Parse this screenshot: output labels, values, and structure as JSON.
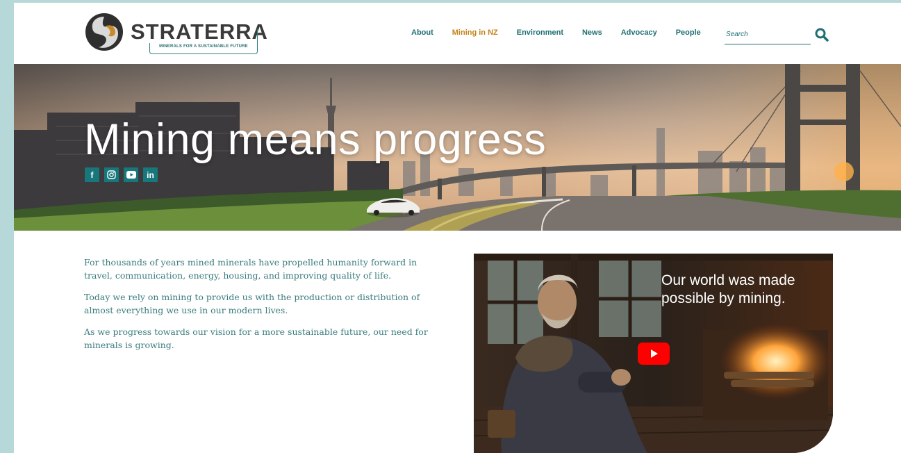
{
  "brand": {
    "name": "STRATERRA",
    "tagline": "MINERALS FOR A SUSTAINABLE FUTURE",
    "accent": "#1f6f73",
    "highlight": "#c4831a"
  },
  "nav": {
    "items": [
      {
        "label": "About",
        "active": false
      },
      {
        "label": "Mining in NZ",
        "active": true
      },
      {
        "label": "Environment",
        "active": false
      },
      {
        "label": "News",
        "active": false
      },
      {
        "label": "Advocacy",
        "active": false
      },
      {
        "label": "People",
        "active": false
      }
    ],
    "search_placeholder": "Search"
  },
  "hero": {
    "title": "Mining means progress",
    "social": [
      {
        "label": "f",
        "icon": "facebook-icon"
      },
      {
        "label": "◎",
        "icon": "instagram-icon"
      },
      {
        "label": "▶",
        "icon": "youtube-icon"
      },
      {
        "label": "in",
        "icon": "linkedin-icon"
      }
    ]
  },
  "intro": {
    "paragraphs": [
      "For thousands of years mined minerals have propelled humanity forward in travel, communication, energy, housing, and improving quality of life.",
      "Today we rely on mining to provide us with the production or distribution of almost everything we use in our modern lives.",
      "As we progress towards our vision for a more sustainable future, our need for minerals is growing."
    ]
  },
  "video": {
    "caption": "Our world was made possible by mining.",
    "play_icon": "youtube-play-icon"
  }
}
